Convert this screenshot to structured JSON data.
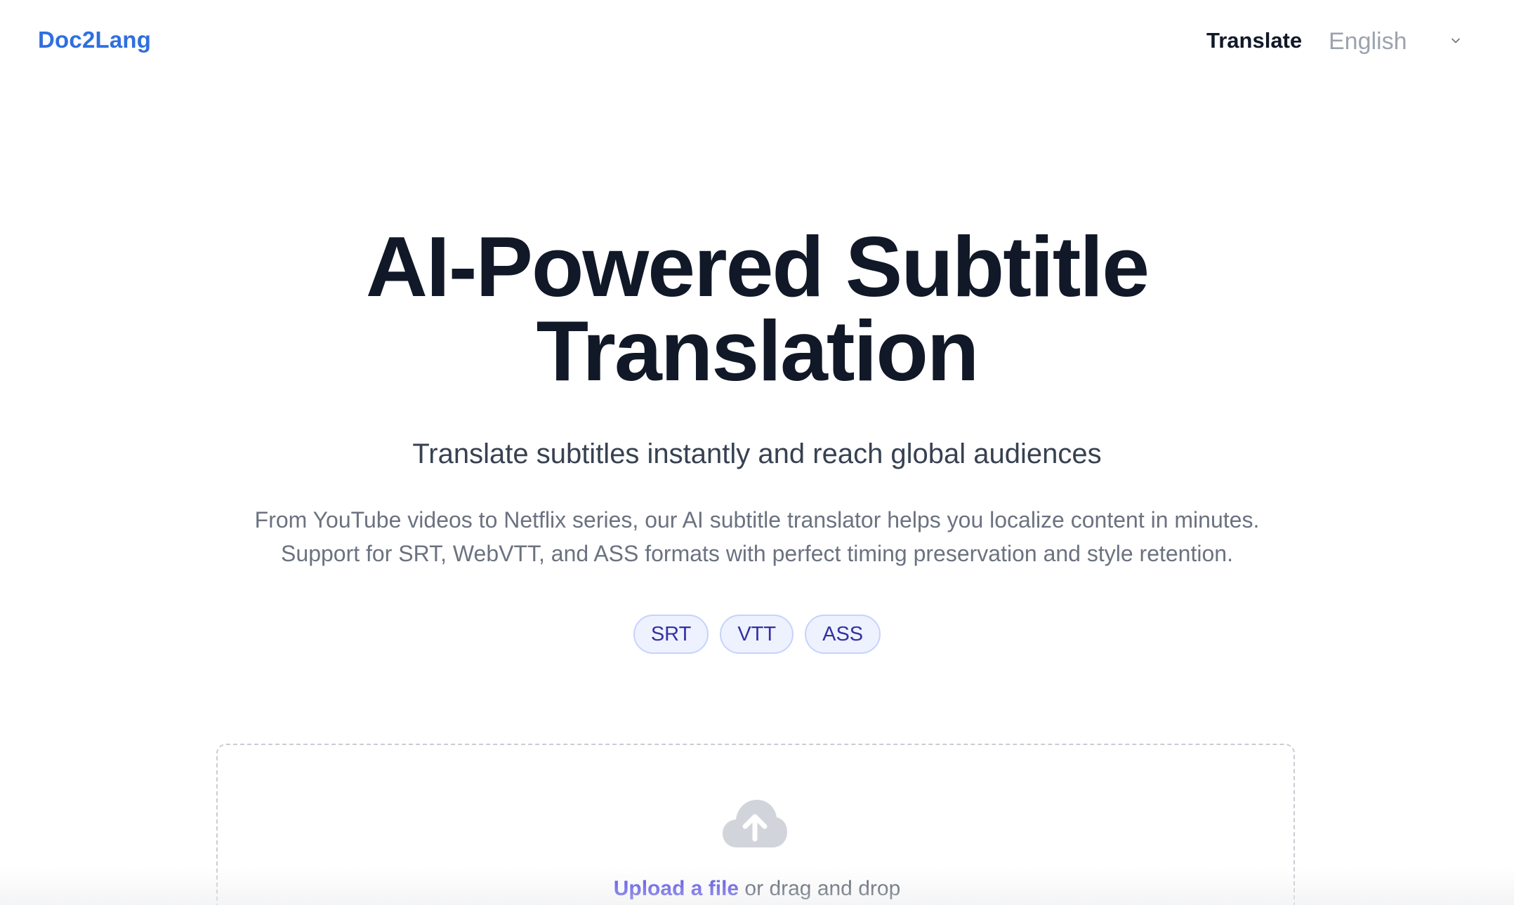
{
  "header": {
    "logo": "Doc2Lang",
    "nav_translate": "Translate",
    "language_selected": "English"
  },
  "hero": {
    "title_line1": "AI-Powered Subtitle",
    "title_line2": "Translation",
    "subtitle": "Translate subtitles instantly and reach global audiences",
    "description_line1": "From YouTube videos to Netflix series, our AI subtitle translator helps you localize content in minutes.",
    "description_line2": "Support for SRT, WebVTT, and ASS formats with perfect timing preservation and style retention."
  },
  "formats": [
    "SRT",
    "VTT",
    "ASS"
  ],
  "upload": {
    "link_text": "Upload a file",
    "rest_text": " or drag and drop",
    "icon": "cloud-upload-icon"
  },
  "colors": {
    "brand": "#2f6fdf",
    "heading": "#111827",
    "chip_bg": "#eef2ff",
    "chip_text": "#3730a3",
    "link": "#4f46e5"
  }
}
